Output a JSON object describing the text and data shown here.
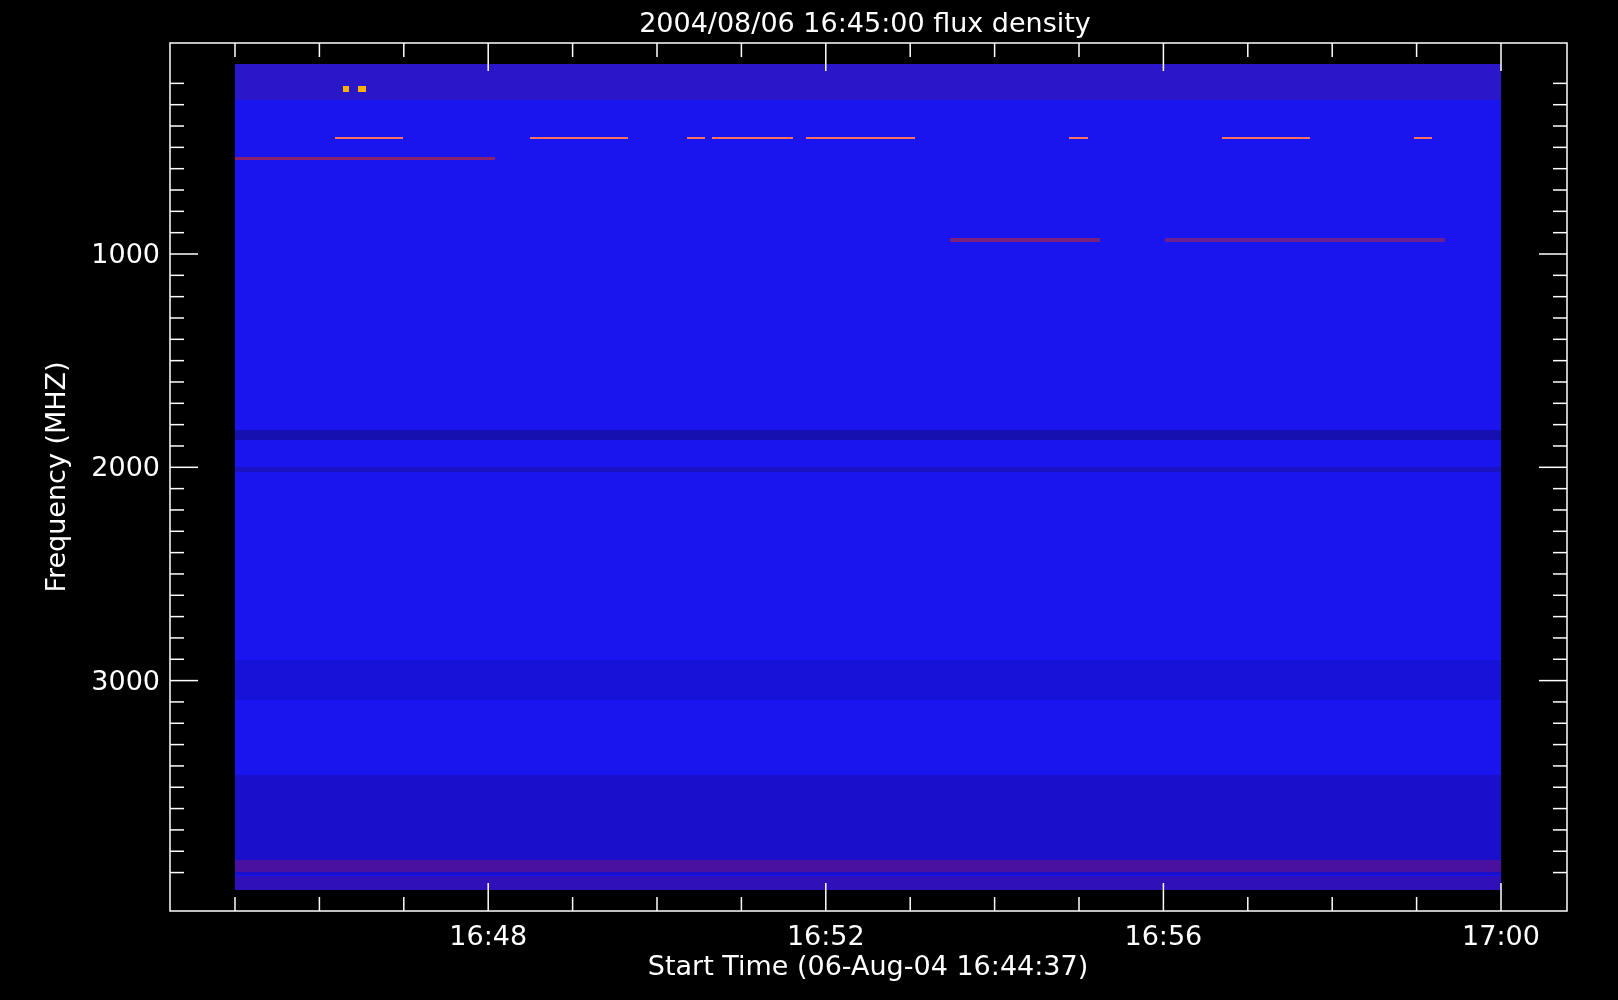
{
  "title": "2004/08/06 16:45:00 flux density",
  "y_axis": {
    "label": "Frequency (MHZ)",
    "ticks": [
      "1000",
      "2000",
      "3000"
    ]
  },
  "x_axis": {
    "label": "Start Time (06-Aug-04 16:44:37)",
    "ticks": [
      "16:48",
      "16:52",
      "16:56",
      "17:00"
    ]
  }
}
